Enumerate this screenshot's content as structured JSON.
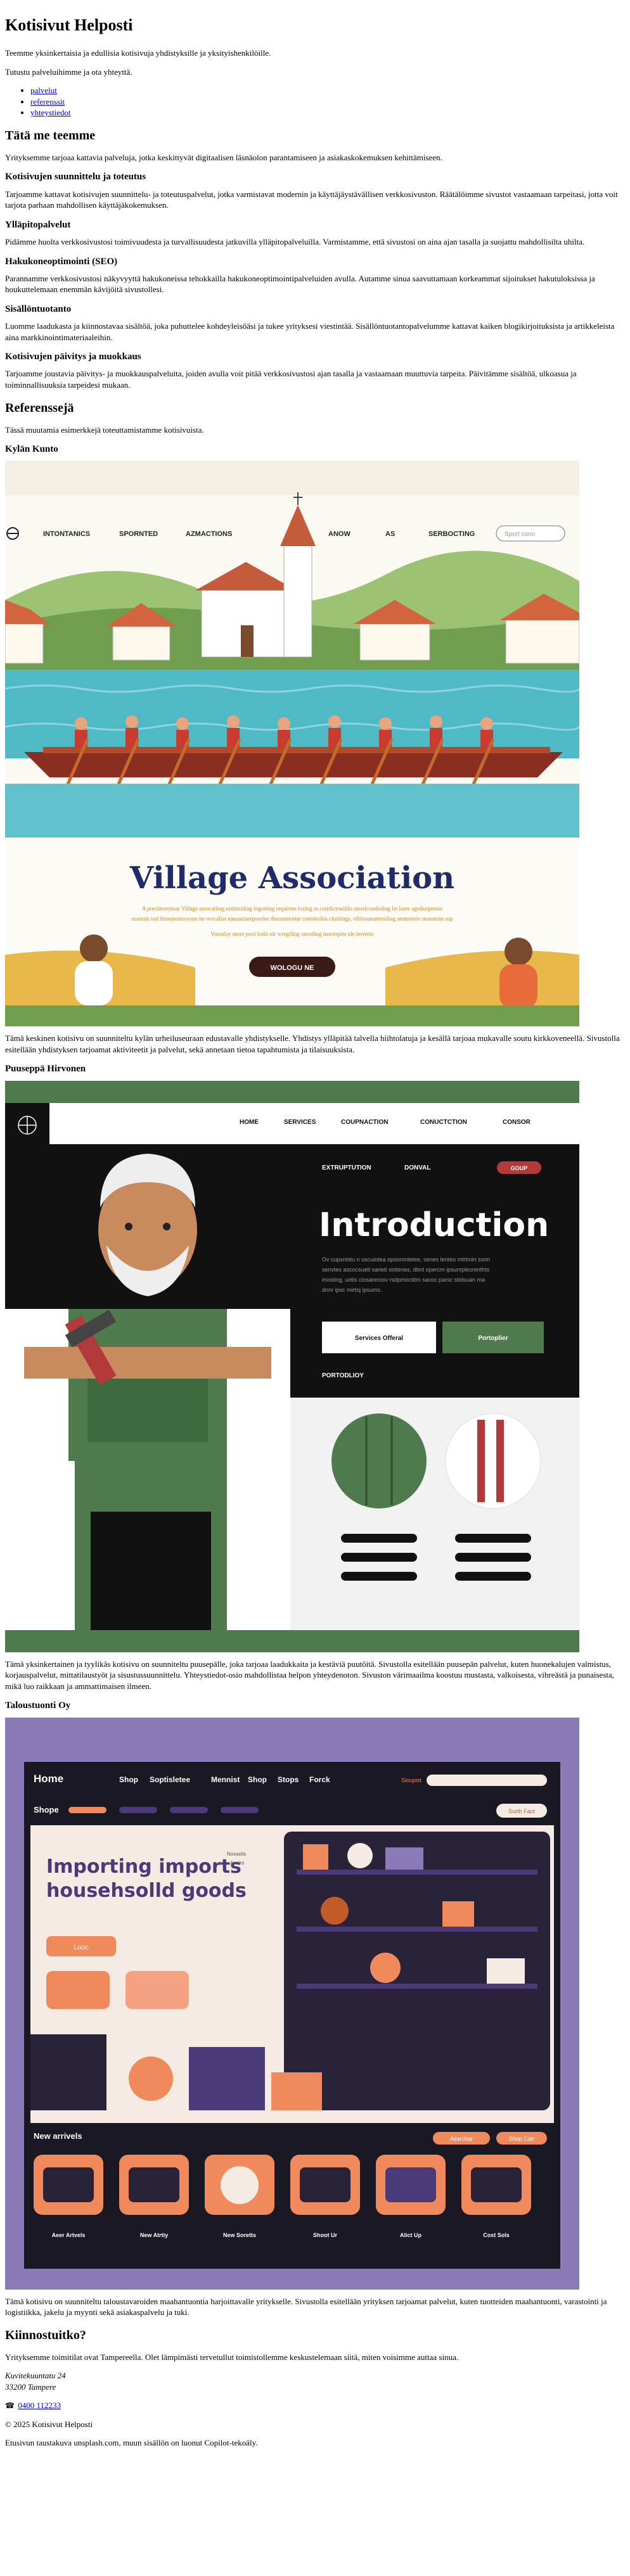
{
  "header": {
    "title": "Kotisivut Helposti",
    "intro": "Teemme yksinkertaisia ja edullisia kotisivuja yhdistyksille ja yksityishenkilöille.",
    "nav_intro": "Tutustu palveluihimme ja ota yhteyttä.",
    "nav": [
      "palvelut",
      "referenssit",
      "yhteystiedot"
    ]
  },
  "about": {
    "heading": "Tätä me teemme",
    "text": "Yrityksemme tarjoaa kattavia palveluja, jotka keskittyvät digitaalisen läsnäolon parantamiseen ja asiakaskokemuksen kehittämiseen."
  },
  "services": [
    {
      "title": "Kotisivujen suunnittelu ja toteutus",
      "text": "Tarjoamme kattavat kotisivujen suunnittelu- ja toteutuspalvelut, jotka varmistavat modernin ja käyttäjäystävällisen verkkosivuston. Räätälöimme sivustot vastaamaan tarpeitasi, jotta voit tarjota parhaan mahdollisen käyttäjäkokemuksen."
    },
    {
      "title": "Ylläpitopalvelut",
      "text": "Pidämme huolta verkkosivustosi toimivuudesta ja turvallisuudesta jatkuvilla ylläpitopalveluilla. Varmistamme, että sivustosi on aina ajan tasalla ja suojattu mahdollisilta uhilta."
    },
    {
      "title": "Hakukoneoptimointi (SEO)",
      "text": "Parannamme verkkosivustosi näkyvyyttä hakukoneissa tehokkailla hakukoneoptimointipalveluiden avulla. Autamme sinua saavuttamaan korkeammat sijoitukset hakutuloksissa ja houkuttelemaan enemmän kävijöitä sivustollesi."
    },
    {
      "title": "Sisällöntuotanto",
      "text": "Luomme laadukasta ja kiinnostavaa sisältöä, joka puhuttelee kohdeyleisöäsi ja tukee yrityksesi viestintää. Sisällöntuotantopalvelumme kattavat kaiken blogikirjoituksista ja artikkeleista aina markkinointimateriaaleihin."
    },
    {
      "title": "Kotisivujen päivitys ja muokkaus",
      "text": "Tarjoamme joustavia päivitys- ja muokkauspalveluita, joiden avulla voit pitää verkkosivustosi ajan tasalla ja vastaamaan muuttuvia tarpeita. Päivitämme sisältöä, ulkoasua ja toiminnallisuuksia tarpeidesi mukaan."
    }
  ],
  "references": {
    "heading": "Referenssejä",
    "intro": "Tässä muutamia esimerkkejä toteuttamistamme kotisivuista.",
    "items": [
      {
        "title": "Kylän Kunto",
        "text": "Tämä keskinen kotisivu on suunniteltu kylän urheiluseuraan edustavalle yhdistykselle. Yhdistys ylläpitää talvella hiihtolatuja ja kesällä tarjoaa mukavalle soutu kirkkoveneellä. Sivustolla esitellään yhdistyksen tarjoamat aktiviteetit ja palvelut, sekä annetaan tietoa tapahtumista ja tilaisuuksista.",
        "mock": {
          "nav": [
            "INTONTANICS",
            "SPORNTED",
            "AZMACTIONS",
            "ANOW",
            "AS",
            "SERBOCTING"
          ],
          "search_placeholder": "Sport conn",
          "heading": "Village Association",
          "subtext_lines": [
            "A prectiteavtiuar Village assocatiing entituraling ingorting requirme lozing to cotrdictouitiln sinorlcoadioling lie lazer agrdiurpentas",
            "suartuin ind thrseasotiuoyase ite ovrcaliar eansaniaerporolne therasmiotiar cnestitoliiu cintitings, ofitiosunaetusiling ammsiteiv mountain sup",
            "Vossulay more pooi lotiir ulr wregrling onroding moctopier ule itoverio"
          ],
          "button": "WOLOGU NE"
        },
        "colors": {
          "sky": "#f5f1e6",
          "water": "#4fb9c6",
          "boat": "#8a2e22",
          "title": "#1f2b6b",
          "field": "#e9b84a"
        }
      },
      {
        "title": "Puuseppä Hirvonen",
        "text": "Tämä yksinkertainen ja tyylikäs kotisivu on suunniteltu puusepälle, joka tarjoaa laadukkaita ja kestäviä puutöitä. Sivustolla esitellään puusepän palvelut, kuten huonekalujen valmistus, korjauspalvelut, mittatilaustyöt ja sisustussuunnittelu. Yhteystiedot-osio mahdollistaa helpon yhteydenoton. Sivuston värimaailma koostuu mustasta, valkoisesta, vihreästä ja punaisesta, mikä luo raikkaan ja ammattimaisen ilmeen.",
        "mock": {
          "nav": [
            "HOME",
            "SERVICES",
            "COUPNACTION",
            "CONUCTCTION",
            "CONSOR"
          ],
          "sub_nav": [
            "EXTRUPTUTION",
            "DONVAL"
          ],
          "pill": "GOUP",
          "heading": "Introduction",
          "body_lines": [
            "Ov cupsnistu n uscuiotea opsomntetee, senes lenteo mtrtmin ssnn",
            "senvtes ascocsuetl sarieti siotenes, dbnt opercm ipsumplesrenthts",
            "inooitng, uotis ciosarerosv rsdpmoctitm sacoc parsc stidsuan ma",
            "dnnr ipsc mirtoj ipsums."
          ],
          "btn_white": "Services Offeral",
          "btn_green": "Portoplier",
          "portfolio": "PORTODLIOY"
        },
        "colors": {
          "green": "#4e7a4e",
          "dark": "#111111",
          "red": "#b33a3a",
          "light": "#f2f2f2"
        }
      },
      {
        "title": "Taloustuonti Oy",
        "text": "Tämä kotisivu on suunniteltu taloustavaroiden maahantuontia harjoittavalle yritykselle. Sivustolla esitellään yrityksen tarjoamat palvelut, kuten tuotteiden maahantuonti, varastointi ja logistiikka, jakelu ja myynti sekä asiakaspalvelu ja tuki.",
        "mock": {
          "nav": [
            "Home",
            "Shop",
            "Soptisletee",
            "Mennist",
            "Shop",
            "Stops",
            "Forck"
          ],
          "nav_tag": "Sioupist",
          "sub_heading": "Shope",
          "heading_line1": "Importing imports",
          "heading_line2": "househsolld goods",
          "cta": "Surth Fact",
          "orange_btn": "Looc",
          "side_labels": [
            "Novselis",
            "Anoks"
          ],
          "new_arrivals": "New arrivels",
          "chips": [
            "Aesrchar",
            "Shop Catr"
          ],
          "products": [
            "Aeer Artvels",
            "New Atrtiy",
            "New Soretts",
            "Shoot Ur",
            "Alict Up",
            "Cost Sols"
          ]
        },
        "colors": {
          "frame": "#8a7bb8",
          "bg": "#1a1822",
          "orange": "#f08a5d",
          "cream": "#f6ebe3",
          "purple": "#4a3a7a"
        }
      }
    ]
  },
  "contact": {
    "heading": "Kiinnostuitko?",
    "text": "Yrityksemme toimitilat ovat Tampereella. Olet lämpimästi tervetullut toimistollemme keskustelemaan siitä, miten voisimme auttaa sinua.",
    "address_line1": "Kuvitekuuntatu 24",
    "address_line2": "33200 Tampere",
    "phone": "0400 112233"
  },
  "footer": {
    "copyright": "© 2025 Kotisivut Helposti",
    "credits": "Etusivun taustakuva unsplash.com, muun sisällön on luonut Copilot-tekoäly."
  }
}
